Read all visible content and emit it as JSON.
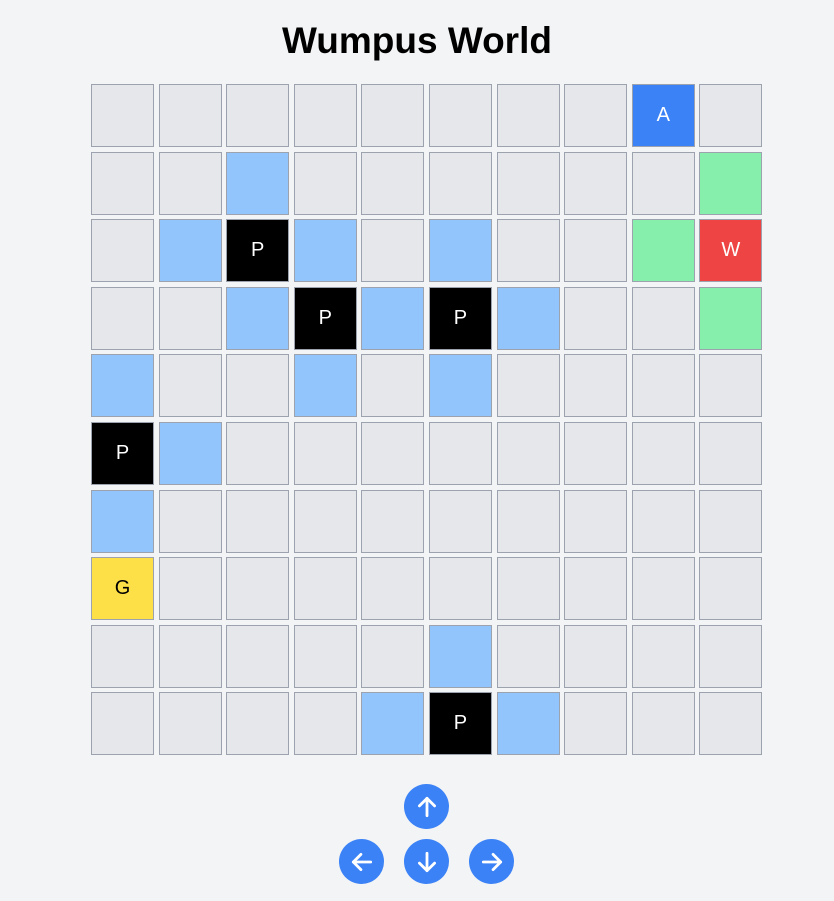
{
  "title": "Wumpus World",
  "colors": {
    "empty": "#e5e7eb",
    "breeze": "#93c5fd",
    "stench": "#86efac",
    "pit": "#000000",
    "agent": "#3b82f6",
    "wumpus": "#ef4444",
    "gold": "#fde047",
    "button": "#3b82f6"
  },
  "grid": [
    [
      {
        "type": "empty"
      },
      {
        "type": "empty"
      },
      {
        "type": "empty"
      },
      {
        "type": "empty"
      },
      {
        "type": "empty"
      },
      {
        "type": "empty"
      },
      {
        "type": "empty"
      },
      {
        "type": "empty"
      },
      {
        "type": "agent",
        "label": "A"
      },
      {
        "type": "empty"
      }
    ],
    [
      {
        "type": "empty"
      },
      {
        "type": "empty"
      },
      {
        "type": "breeze"
      },
      {
        "type": "empty"
      },
      {
        "type": "empty"
      },
      {
        "type": "empty"
      },
      {
        "type": "empty"
      },
      {
        "type": "empty"
      },
      {
        "type": "empty"
      },
      {
        "type": "stench"
      }
    ],
    [
      {
        "type": "empty"
      },
      {
        "type": "breeze"
      },
      {
        "type": "pit",
        "label": "P"
      },
      {
        "type": "breeze"
      },
      {
        "type": "empty"
      },
      {
        "type": "breeze"
      },
      {
        "type": "empty"
      },
      {
        "type": "empty"
      },
      {
        "type": "stench"
      },
      {
        "type": "wumpus",
        "label": "W"
      }
    ],
    [
      {
        "type": "empty"
      },
      {
        "type": "empty"
      },
      {
        "type": "breeze"
      },
      {
        "type": "pit",
        "label": "P"
      },
      {
        "type": "breeze"
      },
      {
        "type": "pit",
        "label": "P"
      },
      {
        "type": "breeze"
      },
      {
        "type": "empty"
      },
      {
        "type": "empty"
      },
      {
        "type": "stench"
      }
    ],
    [
      {
        "type": "breeze"
      },
      {
        "type": "empty"
      },
      {
        "type": "empty"
      },
      {
        "type": "breeze"
      },
      {
        "type": "empty"
      },
      {
        "type": "breeze"
      },
      {
        "type": "empty"
      },
      {
        "type": "empty"
      },
      {
        "type": "empty"
      },
      {
        "type": "empty"
      }
    ],
    [
      {
        "type": "pit",
        "label": "P"
      },
      {
        "type": "breeze"
      },
      {
        "type": "empty"
      },
      {
        "type": "empty"
      },
      {
        "type": "empty"
      },
      {
        "type": "empty"
      },
      {
        "type": "empty"
      },
      {
        "type": "empty"
      },
      {
        "type": "empty"
      },
      {
        "type": "empty"
      }
    ],
    [
      {
        "type": "breeze"
      },
      {
        "type": "empty"
      },
      {
        "type": "empty"
      },
      {
        "type": "empty"
      },
      {
        "type": "empty"
      },
      {
        "type": "empty"
      },
      {
        "type": "empty"
      },
      {
        "type": "empty"
      },
      {
        "type": "empty"
      },
      {
        "type": "empty"
      }
    ],
    [
      {
        "type": "gold",
        "label": "G"
      },
      {
        "type": "empty"
      },
      {
        "type": "empty"
      },
      {
        "type": "empty"
      },
      {
        "type": "empty"
      },
      {
        "type": "empty"
      },
      {
        "type": "empty"
      },
      {
        "type": "empty"
      },
      {
        "type": "empty"
      },
      {
        "type": "empty"
      }
    ],
    [
      {
        "type": "empty"
      },
      {
        "type": "empty"
      },
      {
        "type": "empty"
      },
      {
        "type": "empty"
      },
      {
        "type": "empty"
      },
      {
        "type": "breeze"
      },
      {
        "type": "empty"
      },
      {
        "type": "empty"
      },
      {
        "type": "empty"
      },
      {
        "type": "empty"
      }
    ],
    [
      {
        "type": "empty"
      },
      {
        "type": "empty"
      },
      {
        "type": "empty"
      },
      {
        "type": "empty"
      },
      {
        "type": "breeze"
      },
      {
        "type": "pit",
        "label": "P"
      },
      {
        "type": "breeze"
      },
      {
        "type": "empty"
      },
      {
        "type": "empty"
      },
      {
        "type": "empty"
      }
    ]
  ],
  "controls": {
    "up_icon": "arrow-up-icon",
    "left_icon": "arrow-left-icon",
    "down_icon": "arrow-down-icon",
    "right_icon": "arrow-right-icon"
  }
}
